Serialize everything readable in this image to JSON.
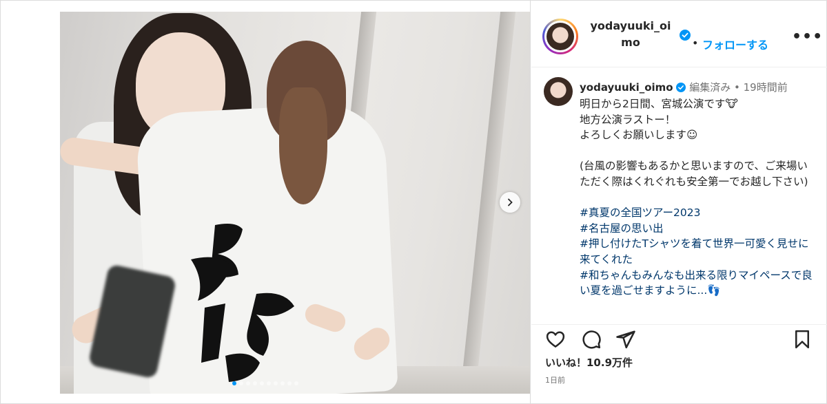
{
  "post": {
    "username": "yodayuuki_oimo",
    "separator": "•",
    "follow_label": "フォローする",
    "more_label": "•••",
    "carousel": {
      "slide_count": 10,
      "active_index": 0
    }
  },
  "caption": {
    "username": "yodayuuki_oimo",
    "edited_label": "編集済み",
    "dot": "•",
    "time_label": "19時間前",
    "lines": [
      "明日から2日間、宮城公演です🐮",
      "地方公演ラストー！",
      "よろしくお願いします☺",
      "",
      "(台風の影響もあるかと思いますので、ご来場いただく際はくれぐれも安全第一でお越し下さい)",
      ""
    ],
    "hashtags": [
      "#真夏の全国ツアー2023",
      "#名古屋の思い出",
      "#押し付けたTシャツを着て世界一可愛く見せに来てくれた",
      "#和ちゃんもみんなも出来る限りマイペースで良い夏を過ごせますように...👣"
    ]
  },
  "stats": {
    "likes_label": "いいね！10.9万件",
    "time_ago": "1日前"
  },
  "colors": {
    "accent": "#0095f6",
    "verified": "#0095f6",
    "hashtag": "#00376b",
    "muted": "#737373",
    "border": "#dbdbdb"
  },
  "icons": [
    "heart-icon",
    "comment-icon",
    "share-icon",
    "bookmark-icon",
    "chevron-right-icon",
    "verified-badge-icon",
    "more-icon"
  ]
}
